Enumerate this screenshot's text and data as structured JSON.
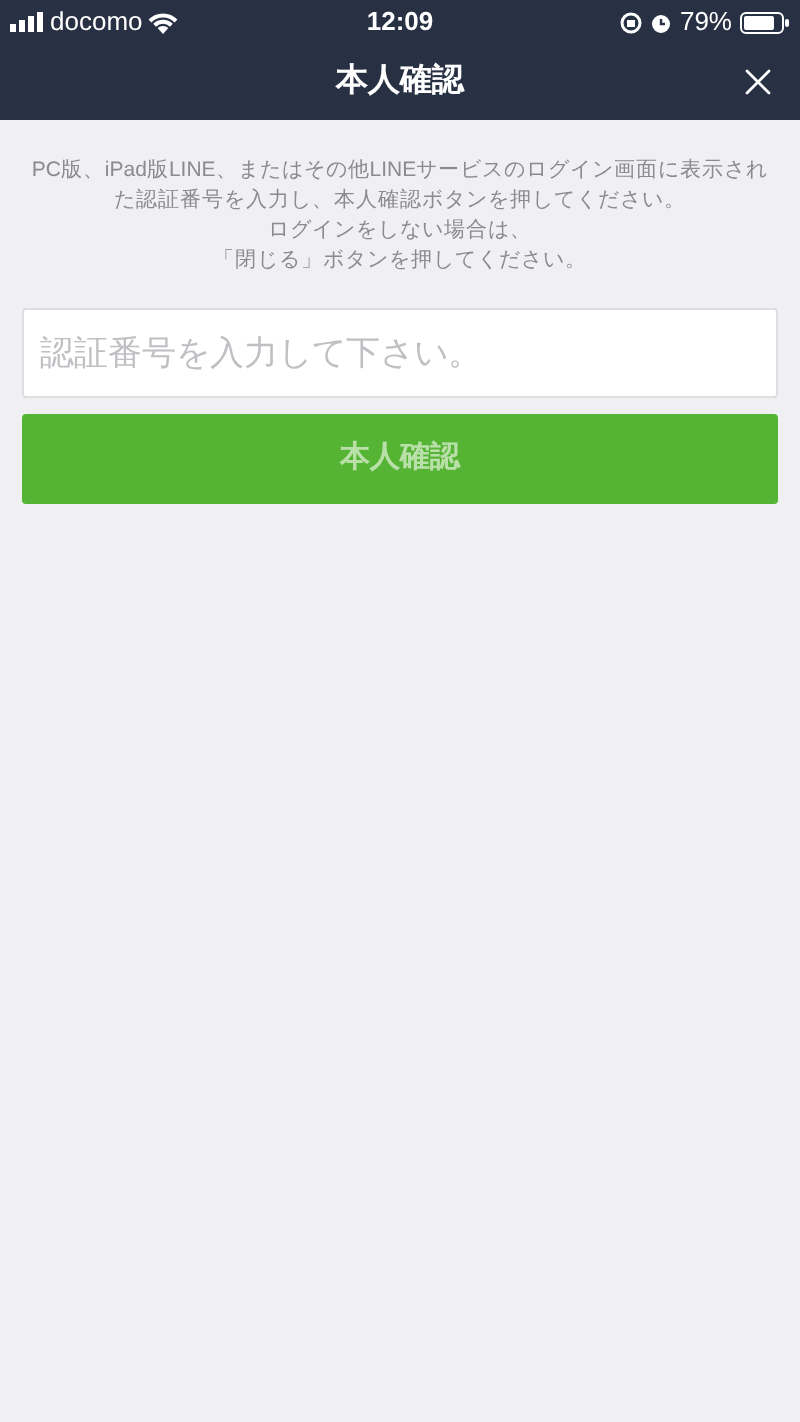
{
  "status_bar": {
    "carrier": "docomo",
    "time": "12:09",
    "battery": "79%"
  },
  "header": {
    "title": "本人確認"
  },
  "instructions": [
    "PC版、iPad版LINE、またはその他LINEサービスのログイン画面に表示され",
    "た認証番号を入力し、本人確認ボタンを押してください。",
    "ログインをしない場合は、",
    "「閉じる」ボタンを押してください。"
  ],
  "code_field": {
    "placeholder": "認証番号を入力して下さい。"
  },
  "confirm_button": {
    "label": "本人確認",
    "disabled": true
  }
}
